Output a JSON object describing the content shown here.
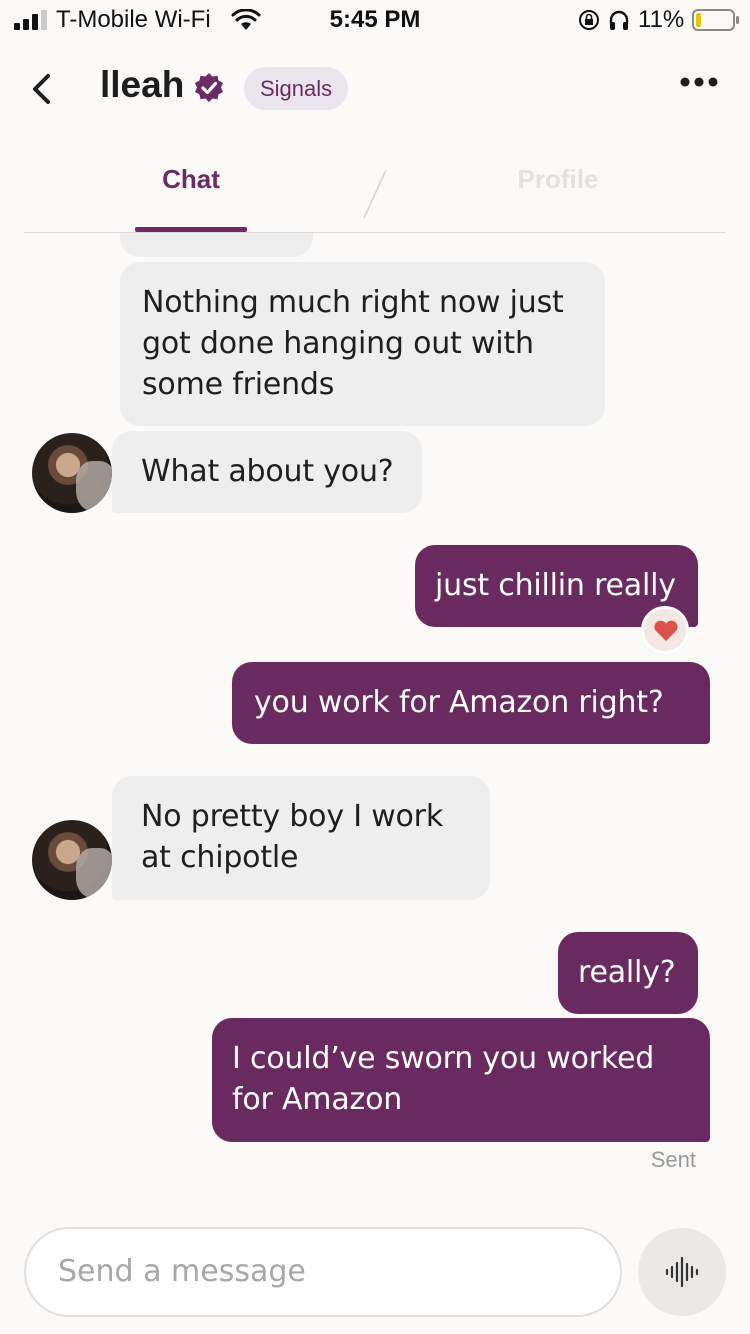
{
  "status_bar": {
    "carrier": "T-Mobile Wi-Fi",
    "time": "5:45 PM",
    "battery": "11%",
    "icons": [
      "signal-icon",
      "wifi-icon",
      "rotation-lock-icon",
      "headphones-icon",
      "battery-icon"
    ]
  },
  "header": {
    "name": "lleah",
    "verified_icon": "verified-badge-icon",
    "signals_label": "Signals",
    "more_icon": "more-icon",
    "back_icon": "chevron-left-icon"
  },
  "tabs": [
    {
      "label": "Chat",
      "active": true
    },
    {
      "label": "Profile",
      "active": false
    }
  ],
  "messages": [
    {
      "from": "them",
      "text": "Nothing much right now just got done hanging out with some friends"
    },
    {
      "from": "them",
      "text": "What about you?"
    },
    {
      "from": "me",
      "text": "just chillin really",
      "reaction": "heart-icon"
    },
    {
      "from": "me",
      "text": "you work for Amazon right?"
    },
    {
      "from": "them",
      "text": "No pretty boy I work at chipotle"
    },
    {
      "from": "me",
      "text": "really?"
    },
    {
      "from": "me",
      "text": "I could’ve sworn you worked for Amazon"
    }
  ],
  "message_lines": {
    "m0": [
      "Nothing much right now just",
      "got done hanging out with",
      "some friends"
    ],
    "m4": [
      "No pretty boy I work",
      "at chipotle"
    ],
    "m6": [
      "I could’ve sworn you worked",
      "for Amazon"
    ]
  },
  "delivery_status": "Sent",
  "composer": {
    "placeholder": "Send a message",
    "voice_icon": "voice-wave-icon"
  },
  "colors": {
    "accent": "#692a5f",
    "incoming_bubble": "#eeeeee",
    "background": "#fbfaf8",
    "reaction_heart": "#d9534a"
  }
}
